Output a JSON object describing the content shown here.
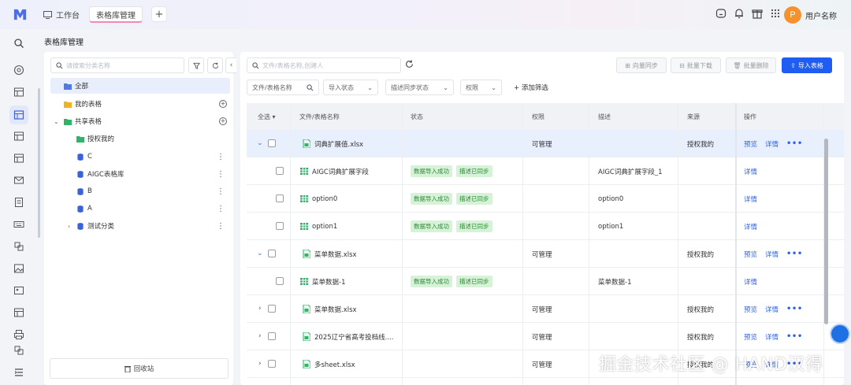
{
  "topbar": {
    "workbench_label": "工作台",
    "active_tab": "表格库管理",
    "add_tab": "+",
    "avatar_initial": "P",
    "username": "用户名称"
  },
  "page_title": "表格库管理",
  "sidebar": {
    "search_placeholder": "请搜索分类名称",
    "items": [
      {
        "label": "全部",
        "icon": "folder-icon",
        "active": true
      },
      {
        "label": "我的表格",
        "icon": "folder-icon"
      },
      {
        "label": "共享表格",
        "icon": "folder-icon",
        "expanded": true
      },
      {
        "label": "授权我的",
        "icon": "folder-icon"
      },
      {
        "label": "C",
        "icon": "database-icon"
      },
      {
        "label": "AIGC表格库",
        "icon": "database-icon"
      },
      {
        "label": "B",
        "icon": "database-icon"
      },
      {
        "label": "A",
        "icon": "database-icon"
      },
      {
        "label": "测试分类",
        "icon": "database-icon"
      }
    ],
    "recycle_label": "回收站"
  },
  "toolbar": {
    "search_placeholder": "文件/表格名称,创建人",
    "vector_sync": "向量同步",
    "batch_download": "批量下载",
    "batch_delete": "批量删除",
    "import_table": "导入表格"
  },
  "filters": {
    "name_filter": "文件/表格名称",
    "import_status": "导入状态",
    "desc_sync_status": "描述同步状态",
    "permission": "权限",
    "add_filter": "添加筛选"
  },
  "table": {
    "headers": {
      "select_all": "全选",
      "name": "文件/表格名称",
      "status": "状态",
      "permission": "权限",
      "description": "描述",
      "source": "来源",
      "actions": "操作"
    },
    "rows": [
      {
        "level": 0,
        "expand": "open",
        "name": "词典扩展值.xlsx",
        "tags": [],
        "permission": "可管理",
        "description": "",
        "source": "授权我的",
        "preview": "预览",
        "detail": "详情",
        "more": "•••",
        "selected": true
      },
      {
        "level": 1,
        "name": "AIGC词典扩展字段",
        "tags": [
          "数据导入成功",
          "描述已同步"
        ],
        "permission": "",
        "description": "AIGC词典扩展字段_1",
        "source": "",
        "detail": "详情"
      },
      {
        "level": 1,
        "name": "option0",
        "tags": [
          "数据导入成功",
          "描述已同步"
        ],
        "permission": "",
        "description": "option0",
        "source": "",
        "detail": "详情"
      },
      {
        "level": 1,
        "name": "option1",
        "tags": [
          "数据导入成功",
          "描述已同步"
        ],
        "permission": "",
        "description": "option1",
        "source": "",
        "detail": "详情"
      },
      {
        "level": 0,
        "expand": "open",
        "name": "菜单数据.xlsx",
        "tags": [],
        "permission": "可管理",
        "description": "",
        "source": "授权我的",
        "preview": "预览",
        "detail": "详情",
        "more": "•••"
      },
      {
        "level": 1,
        "name": "菜单数据-1",
        "tags": [
          "数据导入成功",
          "描述已同步"
        ],
        "permission": "",
        "description": "菜单数据-1",
        "source": "",
        "detail": "详情"
      },
      {
        "level": 0,
        "expand": "closed",
        "name": "菜单数据.xlsx",
        "tags": [],
        "permission": "可管理",
        "description": "",
        "source": "授权我的",
        "preview": "预览",
        "detail": "详情",
        "more": "•••"
      },
      {
        "level": 0,
        "expand": "closed",
        "name": "2025辽宁省高考投档线....",
        "tags": [],
        "permission": "可管理",
        "description": "",
        "source": "授权我的",
        "preview": "预览",
        "detail": "详情",
        "more": "•••"
      },
      {
        "level": 0,
        "expand": "closed",
        "name": "多sheet.xlsx",
        "tags": [],
        "permission": "可管理",
        "description": "",
        "source": "授权我的",
        "preview": "预览",
        "detail": "详情",
        "more": "•••"
      }
    ]
  },
  "watermark": "掘金技术社区 @ HAND汉得",
  "colors": {
    "primary": "#1f5cf2",
    "tag_bg": "#d6f3d8",
    "tag_text": "#2d8a37",
    "link": "#2f62e8",
    "avatar": "#f5922e"
  }
}
